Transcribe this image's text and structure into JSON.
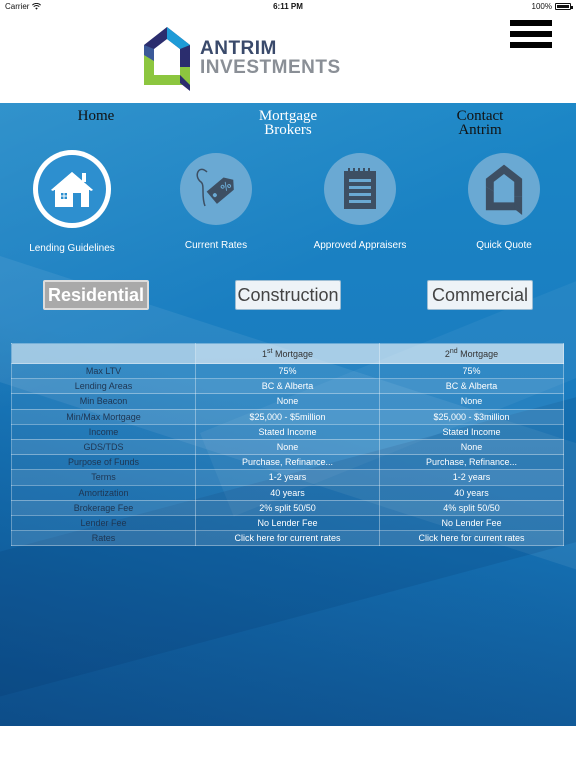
{
  "status": {
    "carrier": "Carrier",
    "time": "6:11 PM",
    "battery": "100%"
  },
  "brand": {
    "line1": "ANTRIM",
    "line2": "INVESTMENTS",
    "colors": {
      "navy": "#2e3a6e",
      "green": "#8cc63f",
      "teal": "#1e9bd7"
    }
  },
  "nav": {
    "home": "Home",
    "brokers_line1": "Mortgage",
    "brokers_line2": "Brokers",
    "contact_line1": "Contact",
    "contact_line2": "Antrim"
  },
  "tiles": [
    {
      "label": "Lending Guidelines",
      "icon": "house-icon"
    },
    {
      "label": "Current Rates",
      "icon": "price-tag-icon"
    },
    {
      "label": "Approved Appraisers",
      "icon": "notepad-icon"
    },
    {
      "label": "Quick Quote",
      "icon": "logo-mark-icon"
    }
  ],
  "types": {
    "residential": "Residential",
    "construction": "Construction",
    "commercial": "Commercial"
  },
  "table": {
    "col1": {
      "num": "1",
      "sup": "st",
      "label": " Mortgage"
    },
    "col2": {
      "num": "2",
      "sup": "nd",
      "label": " Mortgage"
    },
    "rows": [
      {
        "label": "Max LTV",
        "first": "75%",
        "second": "75%"
      },
      {
        "label": "Lending Areas",
        "first": "BC & Alberta",
        "second": "BC & Alberta"
      },
      {
        "label": "Min Beacon",
        "first": "None",
        "second": "None"
      },
      {
        "label": "Min/Max Mortgage",
        "first": "$25,000 - $5million",
        "second": "$25,000 - $3million"
      },
      {
        "label": "Income",
        "first": "Stated Income",
        "second": "Stated Income"
      },
      {
        "label": "GDS/TDS",
        "first": "None",
        "second": "None"
      },
      {
        "label": "Purpose of Funds",
        "first": "Purchase, Refinance...",
        "second": "Purchase, Refinance..."
      },
      {
        "label": "Terms",
        "first": "1-2 years",
        "second": "1-2 years"
      },
      {
        "label": "Amortization",
        "first": "40 years",
        "second": "40 years"
      },
      {
        "label": "Brokerage Fee",
        "first": "2% split 50/50",
        "second": "4% split 50/50"
      },
      {
        "label": "Lender Fee",
        "first": "No Lender Fee",
        "second": "No Lender Fee"
      },
      {
        "label": "Rates",
        "first": "Click here for current rates",
        "second": "Click here for current rates"
      }
    ]
  }
}
